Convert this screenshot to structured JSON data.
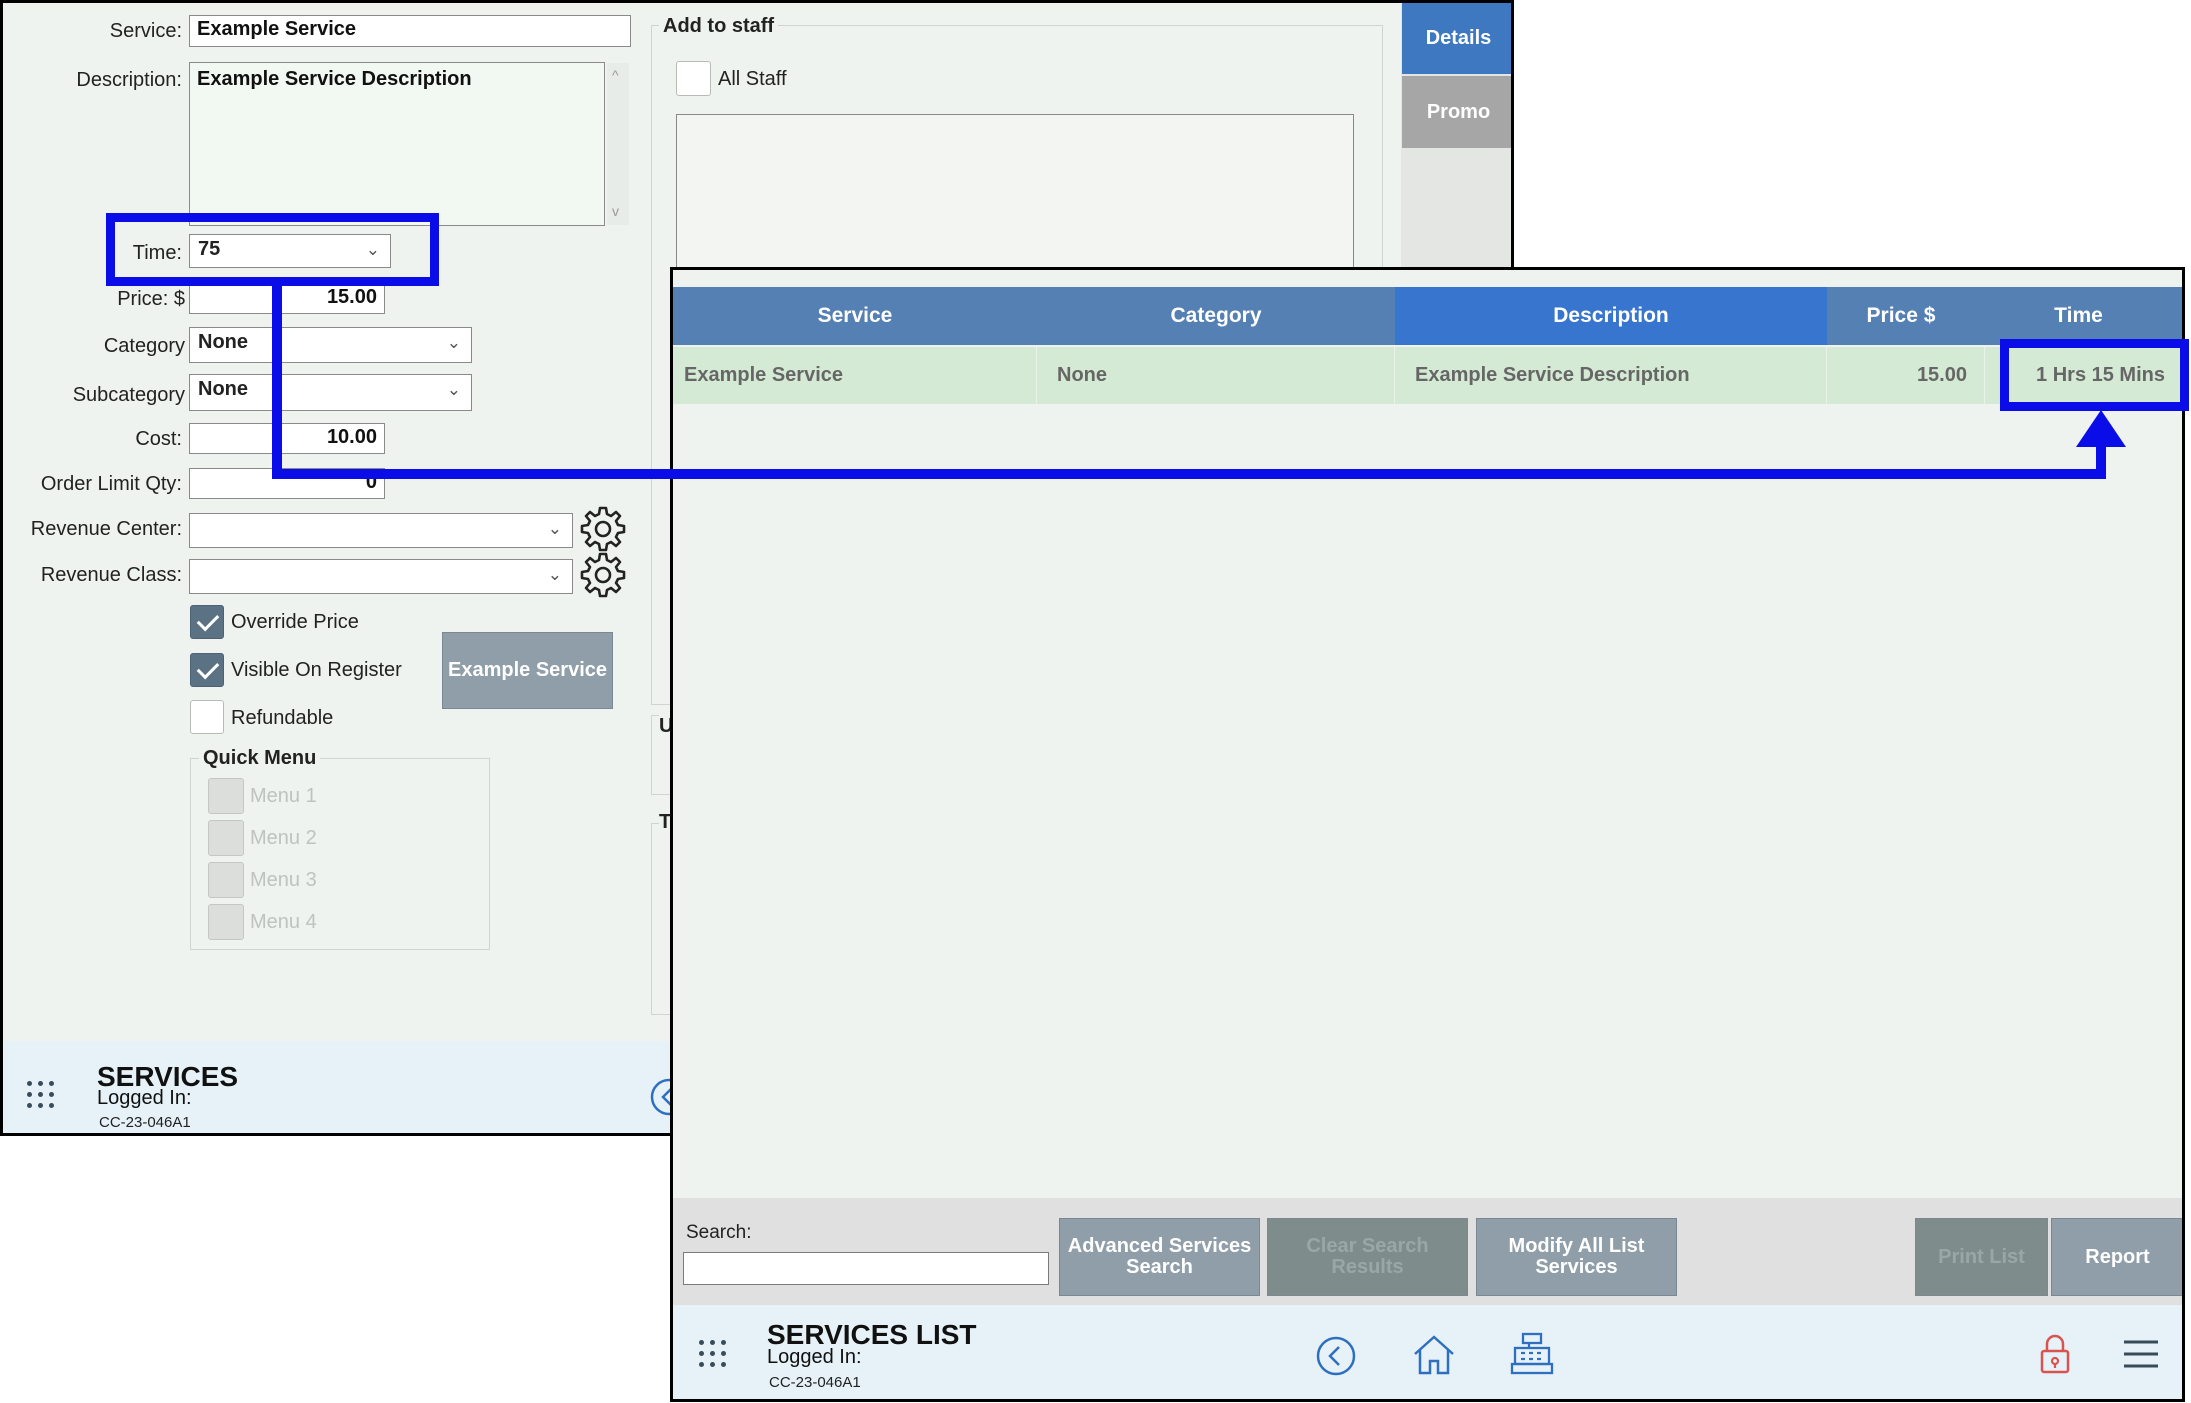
{
  "detail": {
    "service_label": "Service:",
    "service_value": "Example Service",
    "description_label": "Description:",
    "description_value": "Example Service Description",
    "time_label": "Time:",
    "time_value": "75",
    "price_label": "Price: $",
    "price_value": "15.00",
    "category_label": "Category",
    "category_value": "None",
    "subcategory_label": "Subcategory",
    "subcategory_value": "None",
    "cost_label": "Cost:",
    "cost_value": "10.00",
    "order_limit_label": "Order Limit Qty:",
    "order_limit_value": "0",
    "revenue_center_label": "Revenue Center:",
    "revenue_center_value": "",
    "revenue_class_label": "Revenue Class:",
    "revenue_class_value": "",
    "override_price_label": "Override Price",
    "override_price_checked": true,
    "visible_on_register_label": "Visible On Register",
    "visible_on_register_checked": true,
    "refundable_label": "Refundable",
    "refundable_checked": false,
    "preview_button_label": "Example Service",
    "quick_menu": {
      "title": "Quick Menu",
      "items": [
        "Menu 1",
        "Menu 2",
        "Menu 3",
        "Menu 4"
      ]
    },
    "add_to_staff": {
      "title": "Add to staff",
      "all_staff_label": "All Staff"
    },
    "group_u_letter": "U",
    "group_t_letter": "T",
    "tabs": [
      {
        "label": "Details",
        "active": true
      },
      {
        "label": "Promo",
        "active": false
      }
    ],
    "footer": {
      "title": "SERVICES",
      "logged_in": "Logged In:",
      "station_id": "CC-23-046A1"
    }
  },
  "list": {
    "columns": [
      "Service",
      "Category",
      "Description",
      "Price $",
      "Time"
    ],
    "active_column": "Description",
    "rows": [
      {
        "service": "Example Service",
        "category": "None",
        "description": "Example Service Description",
        "price": "15.00",
        "time": "1 Hrs 15 Mins"
      }
    ],
    "search_label": "Search:",
    "search_value": "",
    "buttons": {
      "advanced_search": "Advanced Services Search",
      "clear_search": "Clear Search Results",
      "modify_all": "Modify All List Services",
      "print_list": "Print List",
      "report": "Report"
    },
    "footer": {
      "title": "SERVICES LIST",
      "logged_in": "Logged In:",
      "station_id": "CC-23-046A1"
    }
  },
  "colors": {
    "highlight": "#0b0de8",
    "header_blue": "#5480b4",
    "active_header_blue": "#3875cf",
    "row_green": "#d5ead5",
    "tab_active": "#3d78c0",
    "tab_inactive": "#a6a6a6",
    "lock_red": "#d9534f"
  }
}
